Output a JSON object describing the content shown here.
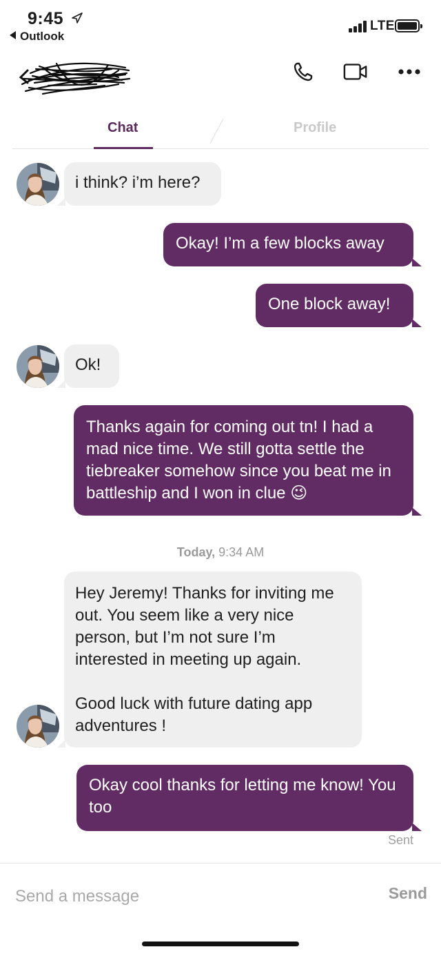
{
  "status_bar": {
    "time": "9:45",
    "back_app": "Outlook",
    "network": "LTE",
    "signal_icon": "signal-bars-icon",
    "battery_icon": "battery-icon"
  },
  "header": {
    "back_icon": "chevron-left-icon",
    "call_icon": "phone-icon",
    "video_icon": "video-camera-icon",
    "more_icon": "more-dots-icon"
  },
  "tabs": {
    "chat": "Chat",
    "profile": "Profile"
  },
  "colors": {
    "accent": "#5c2a5f",
    "outgoing_bubble": "#612c63",
    "incoming_bubble": "#efefef"
  },
  "messages": [
    {
      "direction": "in",
      "text": "i think? i’m here?"
    },
    {
      "direction": "out",
      "text": "Okay! I’m a few blocks away"
    },
    {
      "direction": "out",
      "text": "One block away!"
    },
    {
      "direction": "in",
      "text": "Ok!"
    },
    {
      "direction": "out",
      "text": "Thanks again for coming out tn! I had a mad nice time. We still gotta settle the tiebreaker somehow since you beat me in battleship and I won in clue 😉"
    },
    {
      "direction": "in",
      "text": "Hey Jeremy! Thanks for inviting me out. You seem like a very nice person, but I’m not sure I’m interested in meeting up again.\n\nGood luck with future dating app adventures !"
    },
    {
      "direction": "out",
      "text": "Okay cool thanks for letting me know! You too"
    }
  ],
  "day_divider": {
    "day": "Today,",
    "time": "9:34 AM"
  },
  "delivery_status": "Sent",
  "composer": {
    "placeholder": "Send a message",
    "value": "",
    "send_label": "Send"
  }
}
